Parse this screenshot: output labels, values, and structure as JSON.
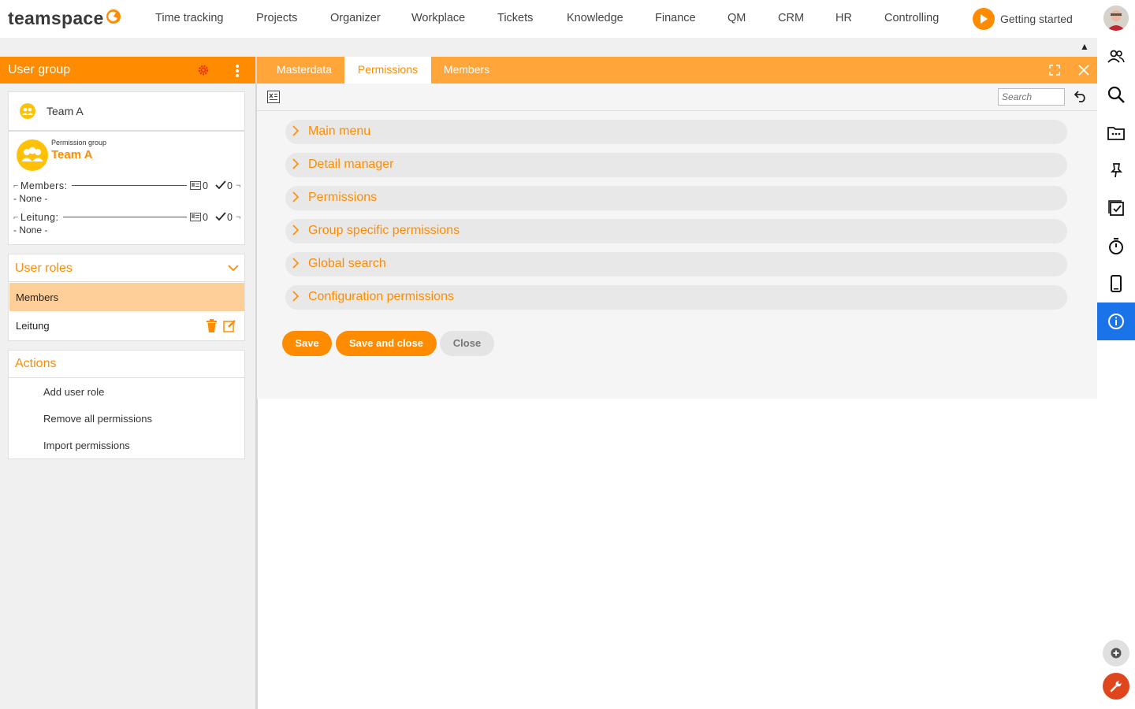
{
  "app": {
    "logo_text": "teamspace"
  },
  "nav": [
    "Time tracking",
    "Projects",
    "Organizer",
    "Workplace",
    "Tickets",
    "Knowledge",
    "Finance",
    "QM",
    "CRM",
    "HR",
    "Controlling"
  ],
  "getting_started": "Getting started",
  "left": {
    "header_title": "User group",
    "group": {
      "name": "Team A",
      "perm_caption": "Permission group",
      "perm_name": "Team A",
      "members_label": "Members:",
      "members_count_a": "0",
      "members_count_b": "0",
      "members_value": "- None -",
      "lead_label": "Leitung:",
      "lead_count_a": "0",
      "lead_count_b": "0",
      "lead_value": "- None -"
    },
    "roles": {
      "title": "User roles",
      "items": [
        "Members",
        "Leitung"
      ]
    },
    "actions": {
      "title": "Actions",
      "items": [
        "Add user role",
        "Remove all permissions",
        "Import permissions"
      ]
    }
  },
  "tabs": [
    "Masterdata",
    "Permissions",
    "Members"
  ],
  "search": {
    "placeholder": "Search"
  },
  "sections": [
    "Main menu",
    "Detail manager",
    "Permissions",
    "Group specific permissions",
    "Global search",
    "Configuration permissions"
  ],
  "buttons": {
    "save": "Save",
    "save_close": "Save and close",
    "close": "Close"
  },
  "colors": {
    "accent": "#ff8c00",
    "tab_bar": "#ffa53a",
    "active_role": "#ffcf99",
    "info_blue": "#1a73e8"
  }
}
